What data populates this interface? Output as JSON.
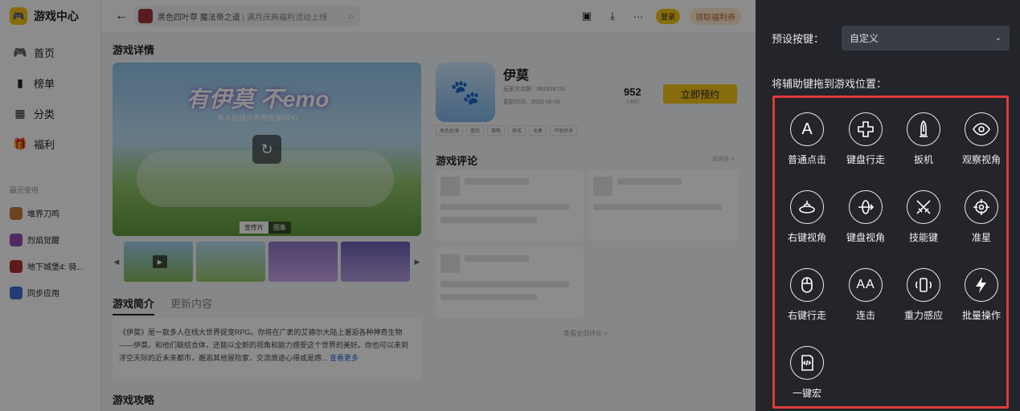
{
  "app": {
    "title": "游戏中心"
  },
  "sidebar": {
    "items": [
      {
        "icon": "gamepad-icon",
        "label": "首页"
      },
      {
        "icon": "ranking-icon",
        "label": "榜单"
      },
      {
        "icon": "category-icon",
        "label": "分类"
      },
      {
        "icon": "gift-icon",
        "label": "福利"
      }
    ],
    "recent_title": "最近使用",
    "recent": [
      {
        "label": "堆界刀鸣",
        "color": "#c77a3a"
      },
      {
        "label": "烈焰觉醒",
        "color": "#8a4fb0"
      },
      {
        "label": "地下城堡4: 骑...",
        "color": "#b0303a"
      },
      {
        "label": "同步应用",
        "color": "#3b6fd6"
      }
    ]
  },
  "topbar": {
    "search_text": "黑色四叶草 魔法帝之道",
    "search_hint": "满月庆典福利活动上线",
    "login": "登录",
    "coupon": "领取福利券"
  },
  "detail": {
    "section_title": "游戏详情",
    "hero_title": "有伊莫 不emo",
    "hero_subtitle": "多人在线大世界捉宠RPG",
    "hero_tabs": [
      "宣传片",
      "图集"
    ],
    "game_name": "伊莫",
    "player_group": "玩家交流群：882929733",
    "update_time": "更新时间：2025-06-09",
    "stat_num": "952",
    "stat_label": "人预约",
    "reserve_button": "立即预约",
    "tags": [
      "角色扮演",
      "冒险",
      "策略",
      "养成",
      "收集",
      "开放世界"
    ],
    "review_title": "游戏评论",
    "review_more": "去评论 >",
    "all_reviews": "查看全部评论 >",
    "tab_intro": "游戏简介",
    "tab_update": "更新内容",
    "intro_text": "《伊莫》是一款多人在线大世界捉宠RPG。你将在广袤的艾德尔大陆上邂逅各种神奇生物——伊莫。和他们联结合体，还能以全新的视角和能力感受这个世界的美好。你也可以来到浮空天际的近未来都市，邂逅其他冒险家，交流旅途心得或是感...",
    "intro_more": "查看更多",
    "guide_title": "游戏攻略"
  },
  "panel": {
    "preset_label": "预设按键：",
    "preset_value": "自定义",
    "drag_hint": "将辅助键拖到游戏位置：",
    "highlight_color": "#e03a3a",
    "keys": [
      {
        "icon": "letter-a-icon",
        "label": "普通点击"
      },
      {
        "icon": "dpad-icon",
        "label": "键盘行走"
      },
      {
        "icon": "bullet-icon",
        "label": "扳机"
      },
      {
        "icon": "eye-icon",
        "label": "观察视角"
      },
      {
        "icon": "right-view-icon",
        "label": "右键视角"
      },
      {
        "icon": "keyboard-view-icon",
        "label": "键盘视角"
      },
      {
        "icon": "swords-icon",
        "label": "技能键"
      },
      {
        "icon": "crosshair-icon",
        "label": "准星"
      },
      {
        "icon": "mouse-icon",
        "label": "右键行走"
      },
      {
        "icon": "double-a-icon",
        "label": "连击"
      },
      {
        "icon": "phone-rotate-icon",
        "label": "重力感应"
      },
      {
        "icon": "lightning-icon",
        "label": "批量操作"
      },
      {
        "icon": "macro-icon",
        "label": "一键宏"
      }
    ],
    "letter_a": "A",
    "letter_aa": "AA"
  }
}
